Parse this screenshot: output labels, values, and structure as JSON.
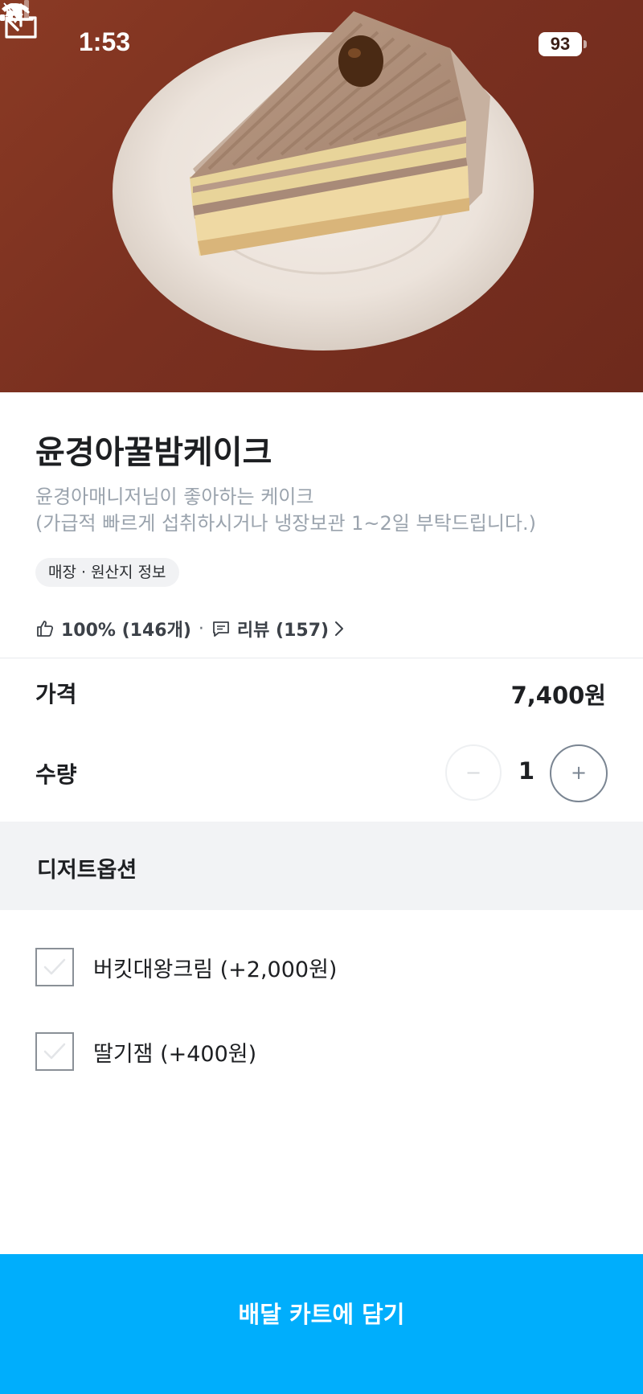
{
  "status_bar": {
    "time": "1:53",
    "battery": "93",
    "icons": [
      "bell-slash-icon",
      "cellular-signal-icon",
      "wifi-icon",
      "battery-icon"
    ]
  },
  "nav": {
    "back_icon": "arrow-left-icon",
    "share_icon": "share-icon"
  },
  "product": {
    "name": "윤경아꿀밤케이크",
    "description_line1": "윤경아매니저님이 좋아하는 케이크",
    "description_line2": "(가급적 빠르게 섭취하시거나 냉장보관 1~2일 부탁드립니다.)",
    "origin_chip": "매장 · 원산지 정보",
    "rating": "100% (146개)",
    "separator": "·",
    "reviews": "리뷰 (157)"
  },
  "price": {
    "label": "가격",
    "value": "7,400원"
  },
  "quantity": {
    "label": "수량",
    "value": "1",
    "minus": "−",
    "plus": "+"
  },
  "options": {
    "section_title": "디저트옵션",
    "items": [
      {
        "label": "버킷대왕크림 (+2,000원)",
        "checked": false
      },
      {
        "label": "딸기잼 (+400원)",
        "checked": false
      }
    ]
  },
  "cta": {
    "label": "배달 카트에 담기"
  },
  "colors": {
    "accent": "#00aefc",
    "text": "#1d1f22",
    "muted": "#9aa3ad",
    "band": "#f2f3f5"
  }
}
